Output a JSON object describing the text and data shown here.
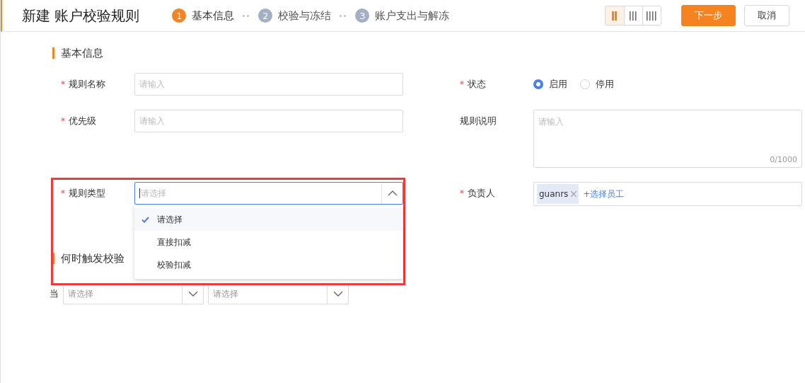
{
  "header": {
    "title": "新建 账户校验规则",
    "steps": [
      {
        "number": "1",
        "label": "基本信息",
        "selected": true
      },
      {
        "number": "2",
        "label": "校验与冻结",
        "selected": false
      },
      {
        "number": "3",
        "label": "账户支出与解冻",
        "selected": false
      }
    ],
    "layout_options": [
      {
        "kind": "two",
        "selected": true
      },
      {
        "kind": "three",
        "selected": false
      },
      {
        "kind": "four",
        "selected": false
      }
    ],
    "buttons": [
      {
        "label": "下一步",
        "kind": "primary"
      },
      {
        "label": "取消",
        "kind": "default"
      }
    ]
  },
  "basic_info": {
    "title": "基本信息",
    "fields": [
      {
        "kind": "input",
        "label": "规则名称",
        "required_mark": "*",
        "placeholder": "请输入"
      },
      {
        "kind": "radio",
        "label": "状态",
        "required_mark": "*",
        "options": [
          {
            "label": "启用",
            "selected": true
          },
          {
            "label": "停用",
            "selected": false
          }
        ]
      },
      {
        "kind": "input",
        "label": "优先级",
        "required_mark": "*",
        "placeholder": "请输入"
      },
      {
        "kind": "textarea",
        "label": "规则说明",
        "placeholder": "请输入",
        "counter": "0/1000"
      },
      {
        "kind": "select",
        "label": "规则类型",
        "required_mark": "*",
        "placeholder": "请选择",
        "expanded": true,
        "options": [
          {
            "label": "请选择",
            "selected": true
          },
          {
            "label": "直接扣减",
            "selected": false
          },
          {
            "label": "校验扣减",
            "selected": false
          }
        ]
      },
      {
        "kind": "people",
        "label": "负责人",
        "required_mark": "*",
        "tags": [
          {
            "name": "guanrs"
          }
        ],
        "add_link": "+选择员工"
      }
    ]
  },
  "trigger": {
    "title": "何时触发校验",
    "condition_label": "当",
    "selects": [
      {
        "placeholder": "请选择"
      },
      {
        "placeholder": "请选择"
      }
    ]
  }
}
